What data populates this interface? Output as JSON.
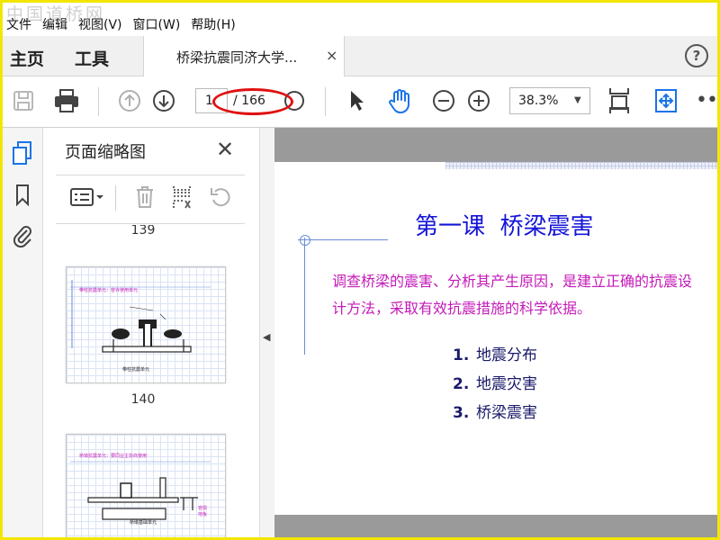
{
  "watermark": "中国道桥网",
  "menu": [
    "文件",
    "编辑",
    "视图(V)",
    "窗口(W)",
    "帮助(H)"
  ],
  "nav": {
    "home": "主页",
    "tools": "工具"
  },
  "tab": {
    "title": "桥梁抗震同济大学...",
    "close": "×"
  },
  "help": "?",
  "toolbar": {
    "current_page": "1",
    "total_pages": "/ 166",
    "zoom": "38.3%"
  },
  "thumbnails_panel": {
    "title": "页面缩略图",
    "close": "✕",
    "pages": [
      {
        "number": "139"
      },
      {
        "number": "140",
        "thumb_heading": "带柱抗震单元：容许使用单元",
        "thumb_caption": "带柱抗震单元"
      },
      {
        "thumb_heading": "桥墩抗震单元：要同业主协商使用",
        "thumb_caption": "桥墩基础单元",
        "side_label": "容损地板"
      }
    ]
  },
  "slide": {
    "title": "第一课  桥梁震害",
    "description": "调查桥梁的震害、分析其产生原因，是建立正确的抗震设计方法，采取有效抗震措施的科学依据。",
    "bullets": [
      {
        "num": "1.",
        "text": "地震分布"
      },
      {
        "num": "2.",
        "text": "地震灾害"
      },
      {
        "num": "3.",
        "text": "桥梁震害"
      }
    ]
  },
  "colors": {
    "frame_border": "#f2e600",
    "annotation_circle": "#e01010",
    "slide_title": "#1515d8",
    "slide_description": "#c41ab8",
    "accent_blue": "#1a73e8"
  }
}
